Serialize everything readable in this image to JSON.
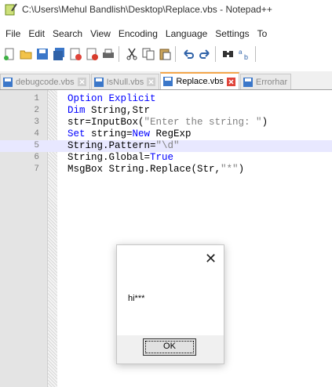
{
  "window": {
    "title": "C:\\Users\\Mehul Bandlish\\Desktop\\Replace.vbs - Notepad++"
  },
  "menu": [
    "File",
    "Edit",
    "Search",
    "View",
    "Encoding",
    "Language",
    "Settings",
    "To"
  ],
  "toolbar": {
    "icons": [
      "new-file-icon",
      "open-file-icon",
      "save-icon",
      "save-all-icon",
      "close-icon",
      "close-all-icon",
      "print-icon",
      "cut-icon",
      "copy-icon",
      "paste-icon",
      "undo-icon",
      "redo-icon",
      "find-icon",
      "replace-icon"
    ]
  },
  "tabs": [
    {
      "label": "debugcode.vbs",
      "active": false
    },
    {
      "label": "IsNull.vbs",
      "active": false
    },
    {
      "label": "Replace.vbs",
      "active": true
    },
    {
      "label": "Errorhar",
      "active": false
    }
  ],
  "editor": {
    "line_numbers": [
      "1",
      "2",
      "3",
      "4",
      "5",
      "6",
      "7"
    ],
    "current_line": 5,
    "lines": [
      [
        {
          "t": "Option Explicit",
          "c": "kw"
        }
      ],
      [
        {
          "t": "Dim",
          "c": "kw"
        },
        {
          "t": " String,Str",
          "c": ""
        }
      ],
      [
        {
          "t": "str=InputBox(",
          "c": ""
        },
        {
          "t": "\"Enter the string: \"",
          "c": "str"
        },
        {
          "t": ")",
          "c": ""
        }
      ],
      [
        {
          "t": "Set",
          "c": "kw"
        },
        {
          "t": " string=",
          "c": ""
        },
        {
          "t": "New",
          "c": "kw"
        },
        {
          "t": " RegExp",
          "c": ""
        }
      ],
      [
        {
          "t": "String.Pattern=",
          "c": ""
        },
        {
          "t": "\"\\d\"",
          "c": "str"
        }
      ],
      [
        {
          "t": "String.Global=",
          "c": ""
        },
        {
          "t": "True",
          "c": "kw"
        }
      ],
      [
        {
          "t": "MsgBox String.Replace(Str,",
          "c": ""
        },
        {
          "t": "\"*\"",
          "c": "str"
        },
        {
          "t": ")",
          "c": ""
        }
      ]
    ]
  },
  "dialog": {
    "close_glyph": "✕",
    "message": "hi***",
    "ok_label": "OK"
  }
}
